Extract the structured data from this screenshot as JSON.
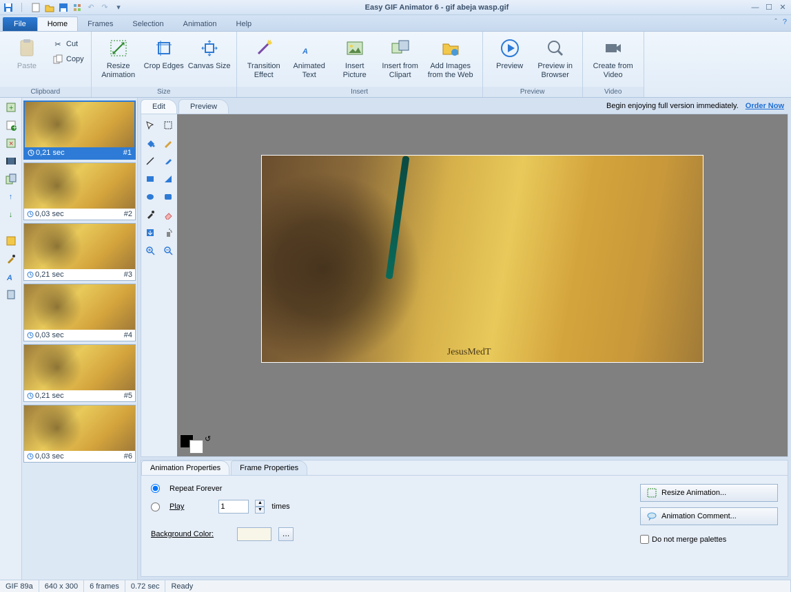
{
  "title": "Easy GIF Animator 6 - gif abeja wasp.gif",
  "ribbon": {
    "file": "File",
    "tabs": [
      "Home",
      "Frames",
      "Selection",
      "Animation",
      "Help"
    ],
    "active_tab": 0,
    "groups": {
      "clipboard": {
        "label": "Clipboard",
        "paste": "Paste",
        "cut": "Cut",
        "copy": "Copy"
      },
      "size": {
        "label": "Size",
        "resize": "Resize Animation",
        "crop": "Crop Edges",
        "canvas": "Canvas Size"
      },
      "insert": {
        "label": "Insert",
        "transition": "Transition Effect",
        "animtext": "Animated Text",
        "picture": "Insert Picture",
        "clipart": "Insert from Clipart",
        "web": "Add Images from the Web"
      },
      "preview": {
        "label": "Preview",
        "preview": "Preview",
        "browser": "Preview in Browser"
      },
      "video": {
        "label": "Video",
        "create": "Create from Video"
      }
    }
  },
  "promo": {
    "text": "Begin enjoying full version immediately.",
    "link": "Order Now"
  },
  "edit_tabs": {
    "edit": "Edit",
    "preview": "Preview",
    "active": 0
  },
  "frames": [
    {
      "time": "0,21 sec",
      "num": "#1",
      "selected": true
    },
    {
      "time": "0,03 sec",
      "num": "#2",
      "selected": false
    },
    {
      "time": "0,21 sec",
      "num": "#3",
      "selected": false
    },
    {
      "time": "0,03 sec",
      "num": "#4",
      "selected": false
    },
    {
      "time": "0,21 sec",
      "num": "#5",
      "selected": false
    },
    {
      "time": "0,03 sec",
      "num": "#6",
      "selected": false
    }
  ],
  "canvas_signature": "JesusMedT",
  "props": {
    "tabs": {
      "anim": "Animation Properties",
      "frame": "Frame Properties",
      "active": 0
    },
    "repeat": "Repeat Forever",
    "play": "Play",
    "play_value": "1",
    "times": "times",
    "bgcolor_label": "Background Color:",
    "resize": "Resize Animation...",
    "comment": "Animation Comment...",
    "nomerge": "Do not merge palettes"
  },
  "status": {
    "fmt": "GIF 89a",
    "dim": "640 x 300",
    "frames": "6 frames",
    "dur": "0.72 sec",
    "ready": "Ready"
  }
}
